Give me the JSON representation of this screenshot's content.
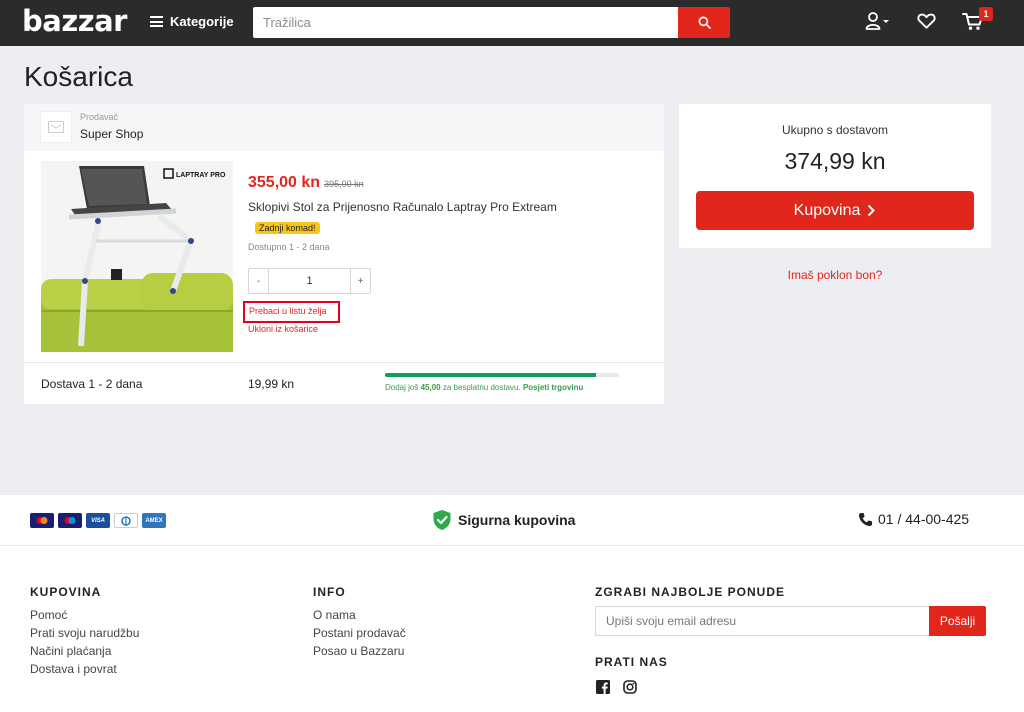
{
  "header": {
    "logo": "bazzar",
    "categories_label": "Kategorije",
    "search_placeholder": "Tražilica",
    "cart_count": "1"
  },
  "page_title": "Košarica",
  "seller": {
    "label": "Prodavač",
    "name": "Super Shop"
  },
  "item": {
    "price": "355,00 kn",
    "old_price": "395,00 kn",
    "name": "Sklopivi Stol za Prijenosno Računalo Laptray Pro Extream",
    "badge": "Zadnji komad!",
    "availability": "Dostupno 1 - 2 dana",
    "quantity": "1",
    "minus": "-",
    "plus": "+",
    "wishlist_link": "Prebaci u listu želja",
    "remove_link": "Ukloni iz košarice",
    "image_brand": "LAPTRAY PRO"
  },
  "shipping": {
    "title": "Dostava 1 - 2 dana",
    "price": "19,99 kn",
    "progress": 0.9,
    "msg_prefix": "Dodaj još",
    "msg_amount": "45,00",
    "msg_suffix": "za besplatnu dostavu.",
    "msg_link": "Posjeti trgovinu"
  },
  "summary": {
    "label": "Ukupno s dostavom",
    "total": "374,99 kn",
    "buy_label": "Kupovina",
    "gift_link": "Imaš poklon bon?"
  },
  "footer": {
    "secure_label": "Sigurna kupovina",
    "phone": "01 / 44-00-425",
    "payment_cards": [
      {
        "name": "mastercard",
        "color": "#1a1f71"
      },
      {
        "name": "maestro",
        "color": "#1a1f71"
      },
      {
        "name": "VISA",
        "color": "#1a4fa0"
      },
      {
        "name": "diners",
        "color": "#ffffff"
      },
      {
        "name": "amex",
        "color": "#2e77bb"
      }
    ],
    "col1": {
      "heading": "KUPOVINA",
      "links": [
        "Pomoć",
        "Prati svoju narudžbu",
        "Načini plaćanja",
        "Dostava i povrat"
      ]
    },
    "col2": {
      "heading": "INFO",
      "links": [
        "O nama",
        "Postani prodavač",
        "Posao u Bazzaru"
      ]
    },
    "newsletter": {
      "heading": "ZGRABI NAJBOLJE PONUDE",
      "placeholder": "Upiši svoju email adresu",
      "button": "Pošalji"
    },
    "social_heading": "PRATI NAS"
  },
  "colors": {
    "accent": "#e1261c",
    "header_bg": "#2b2b2b",
    "progress": "#0f9d58",
    "badge": "#f7c51a"
  }
}
